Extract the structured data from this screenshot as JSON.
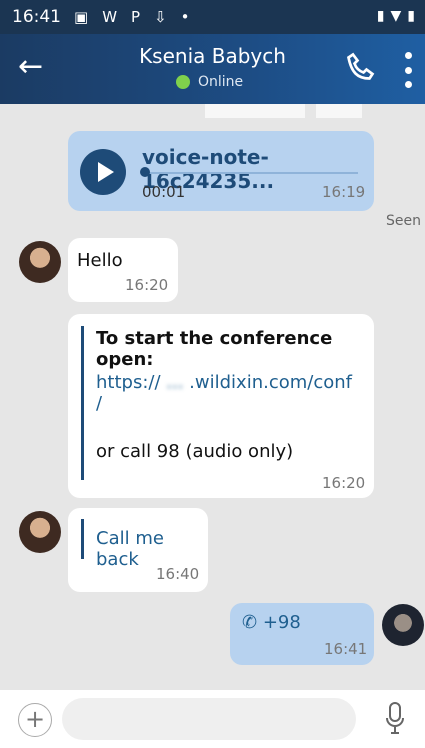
{
  "status_bar": {
    "time": "16:41",
    "icons": [
      "image-icon",
      "w-icon",
      "p-icon",
      "download-icon",
      "dot-icon"
    ],
    "right_icons": [
      "vibrate-icon",
      "wifi-icon",
      "battery-icon"
    ]
  },
  "header": {
    "back_icon": "back-arrow-icon",
    "name": "Ksenia Babych",
    "status": "Online",
    "call_icon": "phone-icon",
    "menu_icon": "kebab-menu-icon"
  },
  "messages": [
    {
      "type": "voice",
      "direction": "out",
      "title": "voice-note-16c24235...",
      "duration": "00:01",
      "time": "16:19"
    },
    {
      "type": "seen",
      "label": "Seen"
    },
    {
      "type": "text",
      "direction": "in",
      "text": "Hello",
      "time": "16:20"
    },
    {
      "type": "conference",
      "direction": "in",
      "title": "To start the conference open:",
      "link_prefix": "https://",
      "link_hidden": "...",
      "link_domain": ".wildixin.com/conf",
      "link_slash": "/",
      "call_prefix": "or call 98",
      "call_hidden": "",
      "call_suffix": "(audio only)",
      "time": "16:20"
    },
    {
      "type": "text",
      "direction": "in",
      "text": "Call me back",
      "time": "16:40"
    },
    {
      "type": "phone",
      "direction": "out",
      "text": "+98",
      "time": "16:41"
    }
  ],
  "composer": {
    "add_icon": "plus-icon",
    "mic_icon": "microphone-icon"
  }
}
